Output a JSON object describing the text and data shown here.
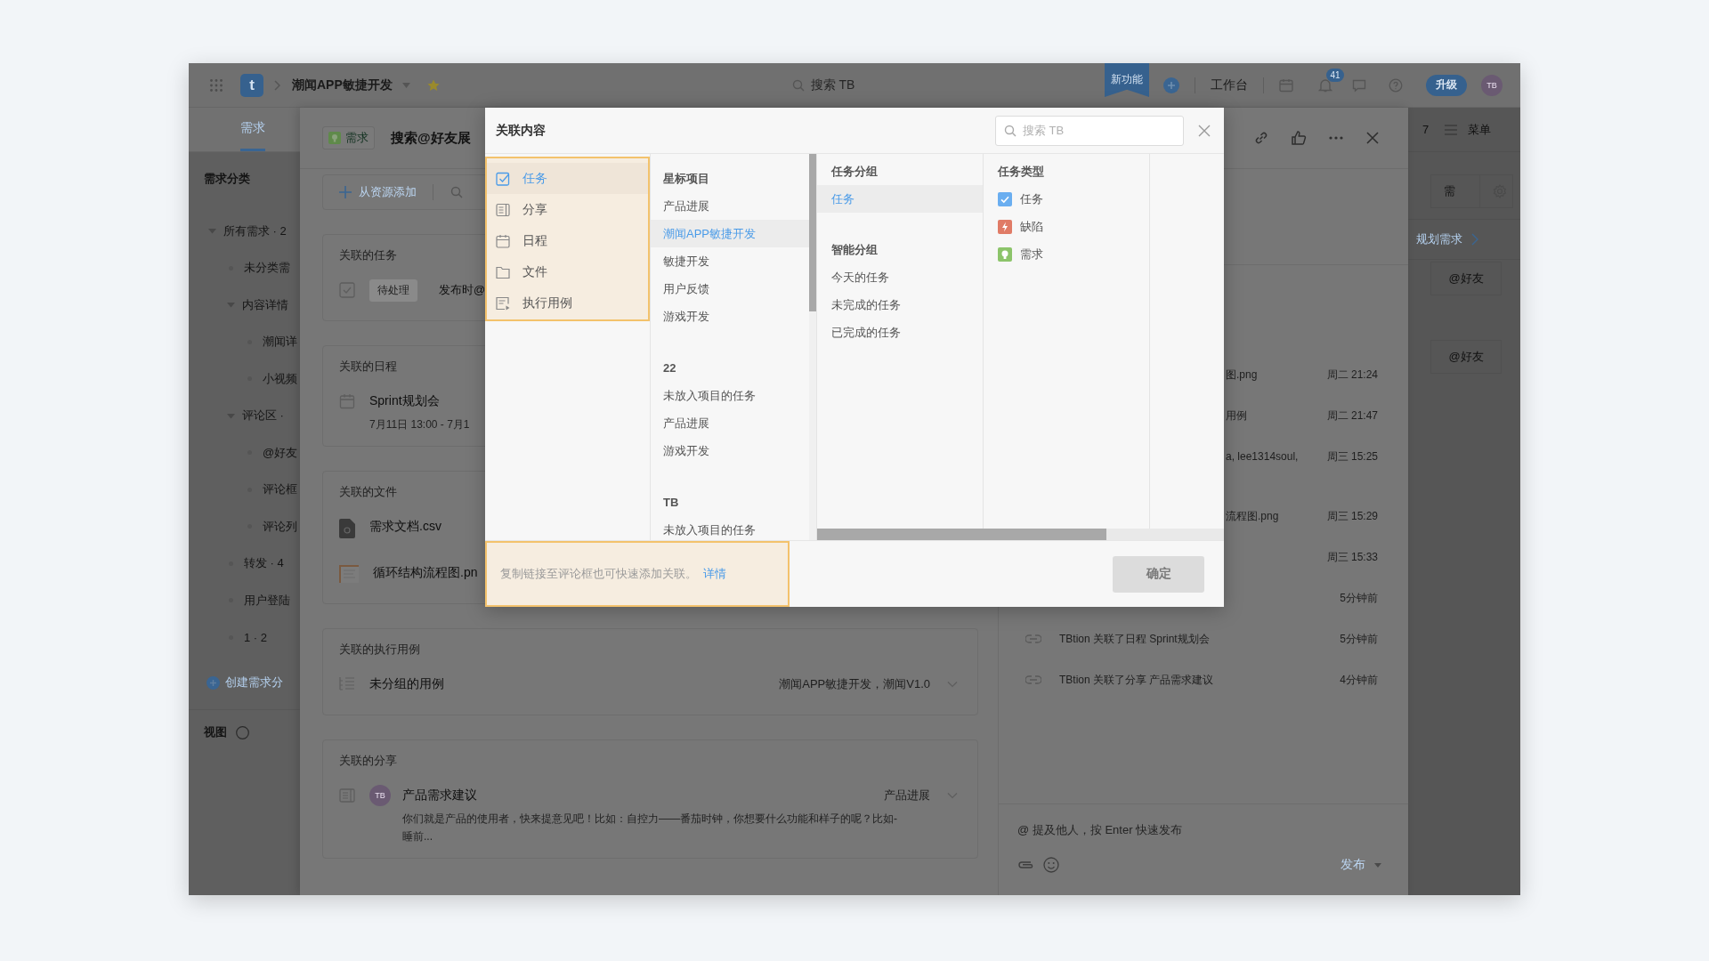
{
  "top_bar": {
    "logo": "t",
    "project": "潮闻APP敏捷开发",
    "search_placeholder": "搜索 TB",
    "new_feature": "新功能",
    "workbench": "工作台",
    "notifications": "41",
    "upgrade": "升级",
    "avatar": "TB"
  },
  "module_tabs": [
    {
      "label": "需求",
      "selected": true
    }
  ],
  "sidebar": {
    "title": "需求分类",
    "tree": [
      {
        "label": "所有需求 · 2",
        "expanded": true,
        "children": [
          {
            "label": "未分类需"
          },
          {
            "label": "内容详情",
            "expanded": true,
            "children": [
              {
                "label": "潮闻详"
              },
              {
                "label": "小视频"
              }
            ]
          },
          {
            "label": "评论区 ·",
            "expanded": true,
            "children": [
              {
                "label": "@好友"
              },
              {
                "label": "评论框"
              },
              {
                "label": "评论列"
              }
            ]
          },
          {
            "label": "转发 · 4"
          },
          {
            "label": "用户登陆"
          },
          {
            "label": "1 · 2"
          }
        ]
      }
    ],
    "create": "创建需求分",
    "views": "视图"
  },
  "detail": {
    "badge": "需求",
    "title": "搜索@好友展",
    "add_from_resources": "从资源添加",
    "cards": [
      {
        "kind": "tasks",
        "title": "关联的任务",
        "items": [
          {
            "tag": "待处理",
            "title": "发布时@"
          }
        ]
      },
      {
        "kind": "events",
        "title": "关联的日程",
        "items": [
          {
            "title": "Sprint规划会",
            "subtitle": "7月11日 13:00 - 7月1"
          }
        ]
      },
      {
        "kind": "files",
        "title": "关联的文件",
        "items": [
          {
            "kind": "document",
            "title": "需求文档.csv"
          },
          {
            "kind": "image",
            "title": "循环结构流程图.pn"
          }
        ]
      },
      {
        "kind": "cases",
        "title": "关联的执行用例",
        "items": [
          {
            "title": "未分组的用例",
            "project": "潮闻APP敏捷开发，潮闻V1.0"
          }
        ]
      },
      {
        "kind": "shares",
        "title": "关联的分享",
        "items": [
          {
            "avatar": "TB",
            "title": "产品需求建议",
            "project": "产品进展",
            "subtitle": "你们就是产品的使用者，快来提意见吧！比如：自控力——番茄时钟，你想要什么功能和样子的呢？比如-睡前..."
          }
        ]
      }
    ],
    "activity": [
      {
        "kind": "partial",
        "text": "图.png",
        "time": "周二 21:24"
      },
      {
        "kind": "partial",
        "text": "用例",
        "time": "周二 21:47"
      },
      {
        "kind": "partial",
        "text": "a, lee1314soul,",
        "time": "周三 15:25"
      },
      {
        "kind": "partial",
        "text": "流程图.png",
        "time": "周三 15:29"
      },
      {
        "kind": "partial",
        "time": "周三 15:33"
      },
      {
        "kind": "partial",
        "time": "5分钟前"
      },
      {
        "kind": "link",
        "text": "TBtion 关联了日程 Sprint规划会",
        "time": "5分钟前"
      },
      {
        "kind": "link",
        "text": "TBtion 关联了分享 产品需求建议",
        "time": "4分钟前"
      }
    ],
    "comment": {
      "placeholder": "@ 提及他人，按 Enter 快速发布",
      "publish": "发布"
    }
  },
  "right_strip": {
    "count": "7",
    "menu": "菜单",
    "type_tab": "需",
    "plan": "规划需求",
    "mentions": [
      "@好友",
      "@好友"
    ]
  },
  "dialog": {
    "title": "关联内容",
    "search_placeholder": "搜索 TB",
    "categories": {
      "highlighted": true,
      "items": [
        {
          "kind": "task",
          "label": "任务",
          "selected": true
        },
        {
          "kind": "share",
          "label": "分享",
          "selected": false
        },
        {
          "kind": "event",
          "label": "日程",
          "selected": false
        },
        {
          "kind": "file",
          "label": "文件",
          "selected": false
        },
        {
          "kind": "testcase",
          "label": "执行用例",
          "selected": false
        }
      ]
    },
    "projects": [
      {
        "header": "星标项目",
        "items": [
          {
            "label": "产品进展",
            "selected": false
          },
          {
            "label": "潮闻APP敏捷开发",
            "selected": true
          },
          {
            "label": "敏捷开发",
            "selected": false
          },
          {
            "label": "用户反馈",
            "selected": false
          },
          {
            "label": "游戏开发",
            "selected": false
          }
        ]
      },
      {
        "header": "22",
        "items": [
          {
            "label": "未放入项目的任务",
            "selected": false
          },
          {
            "label": "产品进展",
            "selected": false
          },
          {
            "label": "游戏开发",
            "selected": false
          }
        ]
      },
      {
        "header": "TB",
        "items": [
          {
            "label": "未放入项目的任务",
            "selected": false
          }
        ]
      }
    ],
    "task_groups": [
      {
        "header": "任务分组",
        "items": [
          {
            "label": "任务",
            "selected": true
          }
        ]
      },
      {
        "header": "智能分组",
        "items": [
          {
            "label": "今天的任务",
            "selected": false
          },
          {
            "label": "未完成的任务",
            "selected": false
          },
          {
            "label": "已完成的任务",
            "selected": false
          }
        ]
      }
    ],
    "task_types": {
      "header": "任务类型",
      "items": [
        {
          "kind": "task",
          "label": "任务"
        },
        {
          "kind": "bug",
          "label": "缺陷"
        },
        {
          "kind": "requirement",
          "label": "需求"
        }
      ]
    },
    "tip": {
      "highlighted": true,
      "text": "复制链接至评论框也可快速添加关联。",
      "link": "详情"
    },
    "confirm": {
      "label": "确定",
      "disabled": true
    }
  }
}
